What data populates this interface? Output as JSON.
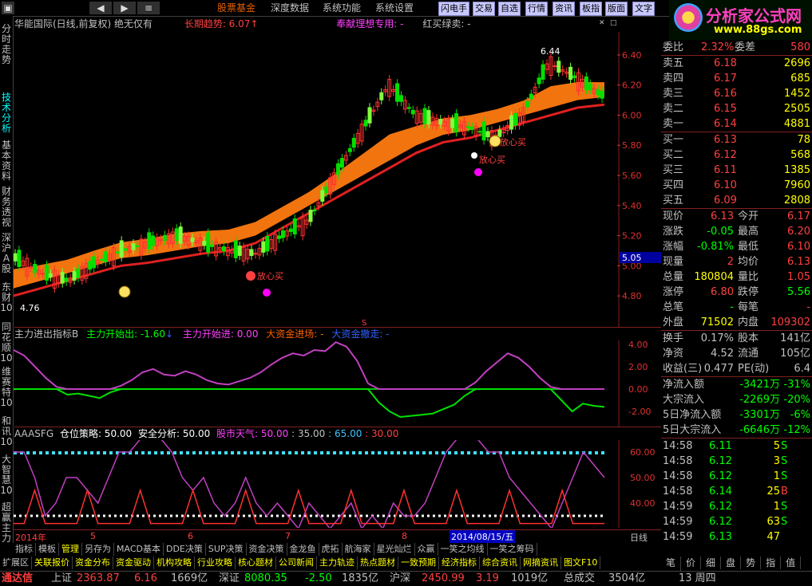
{
  "menu": {
    "items": [
      "股票基金",
      "深度数据",
      "系统功能",
      "系统设置"
    ]
  },
  "toolbar": {
    "buttons": [
      "闪电手",
      "交易",
      "自选",
      "行情",
      "资讯",
      "板指",
      "版面",
      "文字"
    ]
  },
  "logo": {
    "text": "分析家公式网",
    "url": "www.88gs.com"
  },
  "left_tabs": [
    "分时走势",
    "技术分析",
    "基本资料",
    "财务透视",
    "深沪A股",
    "东财10",
    "同花顺10",
    "维赛特10",
    "和讯10",
    "大智慧10",
    "超赢主力"
  ],
  "main_chart": {
    "title": "华能国际(日线,前复权) 绝无仅有",
    "ind1": "长期趋势: 6.07",
    "ind2": "奉献理想专用: -",
    "ind3": "红买绿卖: -",
    "price_labels": [
      "6.40",
      "6.20",
      "6.00",
      "5.80",
      "5.60",
      "5.40",
      "5.20",
      "5.00",
      "4.80"
    ],
    "current_price": "5.05",
    "high_label": "6.44",
    "low_label": "4.76",
    "signal_text": "放心买",
    "s_mark": "S"
  },
  "chart_data": {
    "type": "line",
    "title": "华能国际(日线,前复权)",
    "ylim": [
      4.7,
      6.5
    ],
    "series": [
      {
        "name": "长期趋势",
        "values": [
          4.8,
          4.85,
          4.9,
          4.95,
          5.0,
          5.02,
          5.05,
          5.08,
          5.1,
          5.15,
          5.25,
          5.35,
          5.45,
          5.55,
          5.65,
          5.75,
          5.82,
          5.85,
          5.9,
          5.95,
          6.0,
          6.05,
          6.07
        ]
      },
      {
        "name": "close",
        "values": [
          5.05,
          4.95,
          4.9,
          5.02,
          5.1,
          5.15,
          5.2,
          5.15,
          5.1,
          5.08,
          5.2,
          5.3,
          5.6,
          5.9,
          6.2,
          6.0,
          5.95,
          5.92,
          5.85,
          6.0,
          6.35,
          6.25,
          6.13
        ]
      }
    ]
  },
  "indicator1": {
    "title": "主力进出指标B",
    "f1": "主力开始出: -1.60",
    "f2": "主力开始进: 0.00",
    "f3": "大资金进场: -",
    "f4": "大资金撤走: -",
    "axis": [
      "4.00",
      "2.00",
      "0.00",
      "-2.00"
    ]
  },
  "indicator2": {
    "title": "AAASFG",
    "f1": "仓位策略: 50.00",
    "f2": "安全分析: 50.00",
    "f3": "股市天气: 50.00",
    "f4": ": 35.00",
    "f5": ": 65.00",
    "f6": ": 30.00",
    "axis": [
      "60.00",
      "50.00",
      "40.00"
    ]
  },
  "date_axis": {
    "labels": [
      "2014年",
      "5",
      "6",
      "7",
      "8"
    ],
    "highlight": "2014/08/15/五",
    "period": "日线"
  },
  "quote": {
    "header": {
      "label1": "委比",
      "v1": "2.32%",
      "label2": "委差",
      "v2": "580"
    },
    "sell": [
      {
        "label": "卖五",
        "price": "6.18",
        "vol": "2696"
      },
      {
        "label": "卖四",
        "price": "6.17",
        "vol": "685"
      },
      {
        "label": "卖三",
        "price": "6.16",
        "vol": "1452"
      },
      {
        "label": "卖二",
        "price": "6.15",
        "vol": "2505"
      },
      {
        "label": "卖一",
        "price": "6.14",
        "vol": "4881"
      }
    ],
    "buy": [
      {
        "label": "买一",
        "price": "6.13",
        "vol": "78"
      },
      {
        "label": "买二",
        "price": "6.12",
        "vol": "568"
      },
      {
        "label": "买三",
        "price": "6.11",
        "vol": "1385"
      },
      {
        "label": "买四",
        "price": "6.10",
        "vol": "7960"
      },
      {
        "label": "买五",
        "price": "6.09",
        "vol": "2808"
      }
    ],
    "stats": [
      {
        "l1": "现价",
        "v1": "6.13",
        "l2": "今开",
        "v2": "6.17"
      },
      {
        "l1": "涨跌",
        "v1": "-0.05",
        "l2": "最高",
        "v2": "6.20"
      },
      {
        "l1": "涨幅",
        "v1": "-0.81%",
        "l2": "最低",
        "v2": "6.10"
      },
      {
        "l1": "现量",
        "v1": "2",
        "l2": "均价",
        "v2": "6.13"
      },
      {
        "l1": "总量",
        "v1": "180804",
        "l2": "量比",
        "v2": "1.05"
      },
      {
        "l1": "涨停",
        "v1": "6.80",
        "l2": "跌停",
        "v2": "5.56"
      },
      {
        "l1": "总笔",
        "v1": "-",
        "l2": "每笔",
        "v2": "-"
      },
      {
        "l1": "外盘",
        "v1": "71502",
        "l2": "内盘",
        "v2": "109302"
      }
    ],
    "fund": [
      {
        "l1": "换手",
        "v1": "0.17%",
        "l2": "股本",
        "v2": "141亿"
      },
      {
        "l1": "净资",
        "v1": "4.52",
        "l2": "流通",
        "v2": "105亿"
      },
      {
        "l1": "收益(三)",
        "v1": "0.477",
        "l2": "PE(动)",
        "v2": "6.4"
      }
    ],
    "flow": [
      {
        "l": "净流入额",
        "v1": "-3421万",
        "v2": "-31%"
      },
      {
        "l": "大宗流入",
        "v1": "-2269万",
        "v2": "-20%"
      },
      {
        "l": "5日净流入额",
        "v1": "-3301万",
        "v2": "-6%"
      },
      {
        "l": "5日大宗流入",
        "v1": "-6646万",
        "v2": "-12%"
      }
    ],
    "ticks": [
      {
        "t": "14:58",
        "p": "6.11",
        "v": "5",
        "s": "S"
      },
      {
        "t": "14:58",
        "p": "6.12",
        "v": "3",
        "s": "S"
      },
      {
        "t": "14:58",
        "p": "6.12",
        "v": "1",
        "s": "S"
      },
      {
        "t": "14:58",
        "p": "6.14",
        "v": "25",
        "s": "B"
      },
      {
        "t": "14:59",
        "p": "6.12",
        "v": "1",
        "s": "S"
      },
      {
        "t": "14:59",
        "p": "6.12",
        "v": "63",
        "s": "S"
      },
      {
        "t": "14:59",
        "p": "6.13",
        "v": "47",
        "s": ""
      },
      {
        "t": "14:59",
        "p": "6.13",
        "v": "2",
        "s": "S"
      }
    ]
  },
  "bottom_tabs1": [
    "指标",
    "模板",
    "管理",
    "另存为",
    "MACD基本",
    "DDE决策",
    "SUP决策",
    "资金决策",
    "金龙鱼",
    "虎拓",
    "航海家",
    "星光灿烂",
    "众赢",
    "一笑之均线",
    "一笑之筹码"
  ],
  "bottom_tabs2": [
    "扩展区",
    "关联报价",
    "资金分布",
    "资金驱动",
    "机构攻略",
    "行业攻略",
    "核心题材",
    "公司新闻",
    "主力轨迹",
    "热点题材",
    "一致预期",
    "经济指标",
    "综合资讯",
    "网摘资讯",
    "图文F10"
  ],
  "right_bottom_tabs": [
    "笔",
    "价",
    "细",
    "盘",
    "势",
    "指",
    "值",
    "联"
  ],
  "status": {
    "brand": "通达信",
    "sh_label": "上证",
    "sh_val": "2363.87",
    "sh_chg": "6.16",
    "sh_amt": "1669亿",
    "sz_label": "深证",
    "sz_val": "8080.35",
    "sz_chg": "-2.50",
    "sz_amt": "1835亿",
    "hs_label": "沪深",
    "hs_val": "2450.99",
    "hs_chg": "3.19",
    "hs_amt": "1019亿",
    "total_label": "总成交",
    "total_val": "3504亿",
    "time": "13 周四"
  }
}
